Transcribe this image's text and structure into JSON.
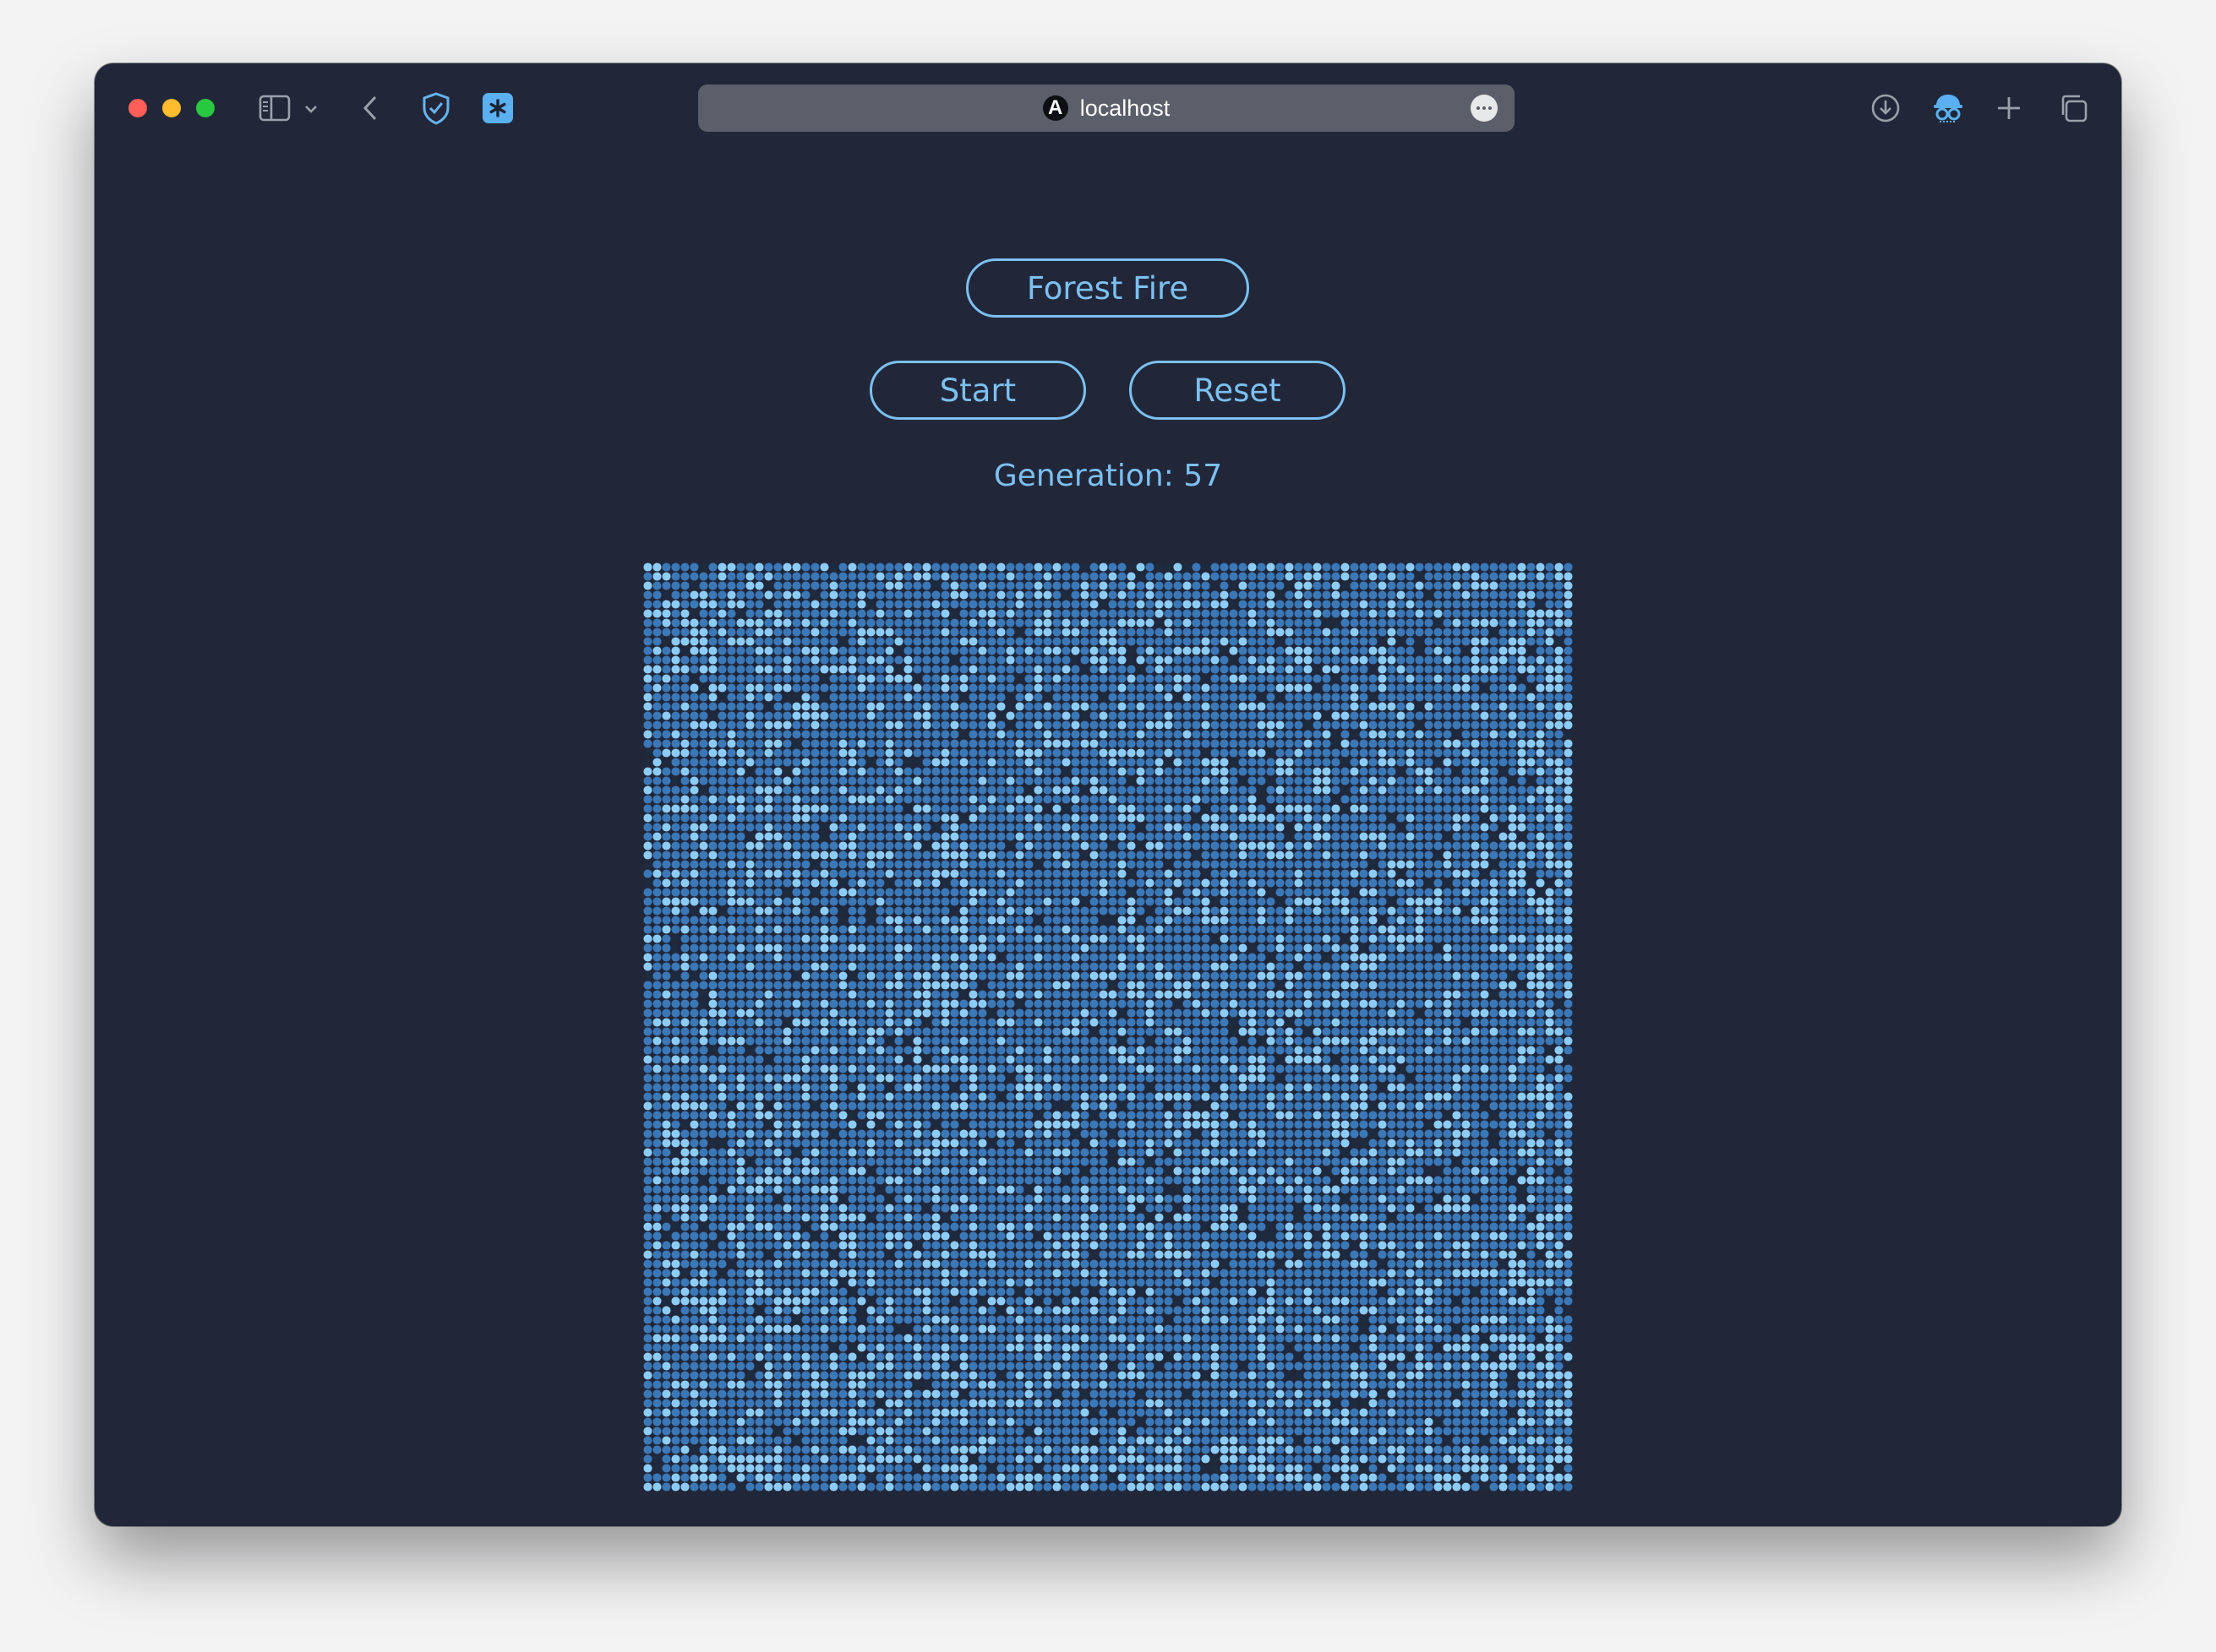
{
  "browser": {
    "url": "localhost",
    "site_icon": "A"
  },
  "app": {
    "title": "Forest Fire",
    "start_label": "Start",
    "reset_label": "Reset",
    "generation_text": "Generation: 57"
  },
  "grid": {
    "rows": 100,
    "cols": 100,
    "cell_state_colors": {
      "empty": "#1e2a3e",
      "tree": "#3a78b8",
      "new_tree": "#8cccf8"
    }
  },
  "theme": {
    "background": "#212739",
    "accent": "#7cc0f1"
  },
  "icons": [
    "sidebar-icon",
    "chevron-down-icon",
    "back-icon",
    "shield-icon",
    "extension-icon",
    "download-icon",
    "privacy-icon",
    "new-tab-icon",
    "tabs-overview-icon",
    "more-icon"
  ]
}
